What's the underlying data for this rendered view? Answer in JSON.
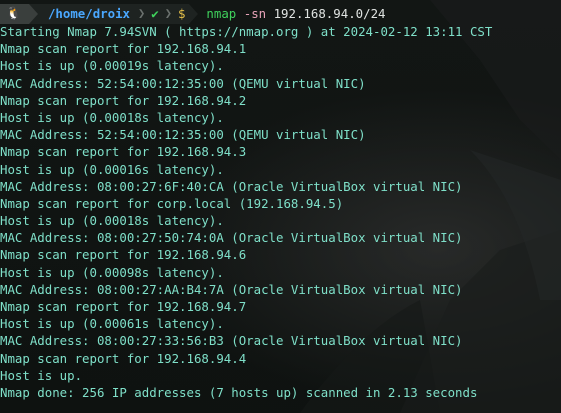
{
  "prompt": {
    "os_icon": "tux-icon",
    "os_glyph": "🐧",
    "separator_glyph": "❯",
    "directory": "/home/droix",
    "status_glyph": "✔",
    "dollar": "$",
    "command_name": "nmap",
    "command_flag": "-sn",
    "command_target": "192.168.94.0/24"
  },
  "output_lines": [
    "Starting Nmap 7.94SVN ( https://nmap.org ) at 2024-02-12 13:11 CST",
    "Nmap scan report for 192.168.94.1",
    "Host is up (0.00019s latency).",
    "MAC Address: 52:54:00:12:35:00 (QEMU virtual NIC)",
    "Nmap scan report for 192.168.94.2",
    "Host is up (0.00018s latency).",
    "MAC Address: 52:54:00:12:35:00 (QEMU virtual NIC)",
    "Nmap scan report for 192.168.94.3",
    "Host is up (0.00016s latency).",
    "MAC Address: 08:00:27:6F:40:CA (Oracle VirtualBox virtual NIC)",
    "Nmap scan report for corp.local (192.168.94.5)",
    "Host is up (0.00018s latency).",
    "MAC Address: 08:00:27:50:74:0A (Oracle VirtualBox virtual NIC)",
    "Nmap scan report for 192.168.94.6",
    "Host is up (0.00098s latency).",
    "MAC Address: 08:00:27:AA:B4:7A (Oracle VirtualBox virtual NIC)",
    "Nmap scan report for 192.168.94.7",
    "Host is up (0.00061s latency).",
    "MAC Address: 08:00:27:33:56:B3 (Oracle VirtualBox virtual NIC)",
    "Nmap scan report for 192.168.94.4",
    "Host is up.",
    "Nmap done: 256 IP addresses (7 hosts up) scanned in 2.13 seconds"
  ],
  "colors": {
    "output_text": "#7fe0c9",
    "directory": "#4aa8ff",
    "status_ok": "#3fd15c",
    "dollar": "#e6c04a",
    "command_name": "#3fd15c",
    "command_flag": "#e7a3b8"
  }
}
